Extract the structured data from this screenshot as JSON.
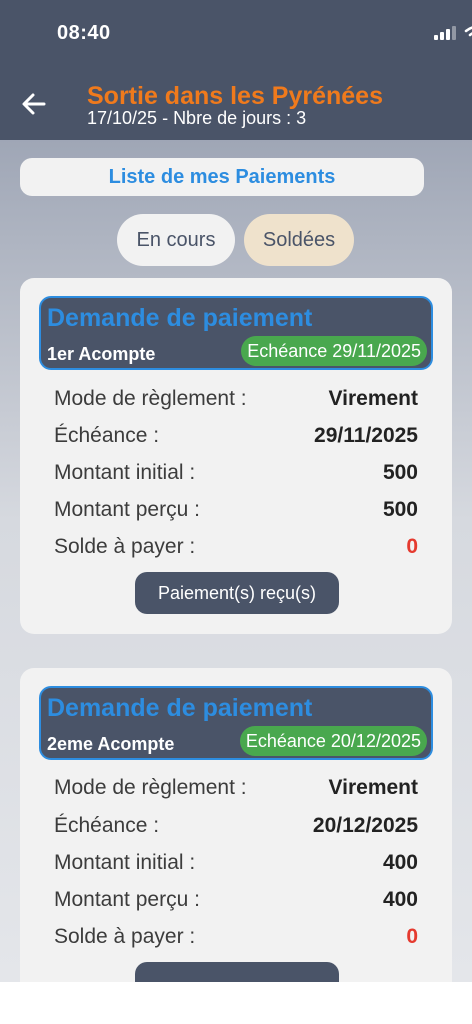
{
  "status_bar": {
    "time": "08:40"
  },
  "header": {
    "title": "Sortie dans les Pyrénées",
    "subtitle": "17/10/25 - Nbre de jours : 3",
    "accent_color": "#f07a1c",
    "background_color": "#4a5468"
  },
  "list_button": {
    "label": "Liste de mes Paiements"
  },
  "filters": [
    {
      "label": "En cours",
      "selected": false
    },
    {
      "label": "Soldées",
      "selected": true
    }
  ],
  "payments": [
    {
      "title": "Demande de paiement",
      "subtitle": "1er Acompte",
      "due_badge": "Echéance 29/11/2025",
      "rows": [
        {
          "label": "Mode de règlement :",
          "value": "Virement"
        },
        {
          "label": "Échéance :",
          "value": "29/11/2025"
        },
        {
          "label": "Montant initial :",
          "value": "500"
        },
        {
          "label": "Montant perçu :",
          "value": "500"
        },
        {
          "label": "Solde à payer :",
          "value": "0"
        }
      ],
      "button_label": "Paiement(s) reçu(s)"
    },
    {
      "title": "Demande de paiement",
      "subtitle": "2eme Acompte",
      "due_badge": "Echéance 20/12/2025",
      "rows": [
        {
          "label": "Mode de règlement :",
          "value": "Virement"
        },
        {
          "label": "Échéance :",
          "value": "20/12/2025"
        },
        {
          "label": "Montant initial :",
          "value": "400"
        },
        {
          "label": "Montant perçu :",
          "value": "400"
        },
        {
          "label": "Solde à payer :",
          "value": "0"
        }
      ],
      "button_label": ""
    }
  ],
  "colors": {
    "title_blue": "#2d8de0",
    "badge_green": "#49a84e",
    "balance_red": "#e53a2f"
  }
}
